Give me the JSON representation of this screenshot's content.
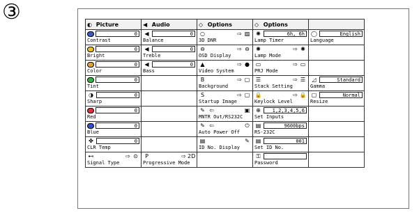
{
  "step_marker": "③",
  "headers": [
    {
      "icon": "picture-icon",
      "glyph": "◐",
      "label": "Picture"
    },
    {
      "icon": "audio-icon",
      "glyph": "◀",
      "label": "Audio"
    },
    {
      "icon": "options-icon",
      "glyph": "◇",
      "label": "Options"
    },
    {
      "icon": "options-icon",
      "glyph": "◇",
      "label": "Options"
    }
  ],
  "rows": [
    [
      {
        "name": "contrast",
        "label": "Contrast",
        "value": "0",
        "swatch": "#3f57c8"
      },
      {
        "name": "balance",
        "label": "Balance",
        "value": "0",
        "glyph": "◀"
      },
      {
        "name": "3d-dnr",
        "label": "3D DNR",
        "glyph": "○",
        "arrow": "⇨",
        "glyph2": "▨"
      },
      {
        "name": "lamp-timer",
        "label": "Lamp Timer",
        "value": "6h,  6h",
        "glyph": "✺"
      },
      {
        "name": "language",
        "label": "Language",
        "value": "English",
        "glyph": "◯"
      }
    ],
    [
      {
        "name": "bright",
        "label": "Bright",
        "value": "0",
        "glyph": "✿",
        "swatch": "#f0c020"
      },
      {
        "name": "treble",
        "label": "Treble",
        "value": "0",
        "glyph": "◀"
      },
      {
        "name": "osd-display",
        "label": "OSD Display",
        "glyph": "⊖",
        "arrow": "⇨",
        "glyph2": "⊖"
      },
      {
        "name": "lamp-mode",
        "label": "Lamp Mode",
        "glyph": "✺",
        "arrow": "⇨",
        "glyph2": "✺"
      },
      {
        "name": "blank-1",
        "label": ""
      }
    ],
    [
      {
        "name": "color",
        "label": "Color",
        "value": "0",
        "swatch": "#e4a030"
      },
      {
        "name": "bass",
        "label": "Bass",
        "value": "0",
        "glyph": "◀"
      },
      {
        "name": "video-system",
        "label": "Video System",
        "glyph": "▲",
        "arrow": "⇨",
        "glyph2": "●"
      },
      {
        "name": "prj-mode",
        "label": "PRJ Mode",
        "glyph": "▭",
        "arrow": "⇨",
        "glyph2": "▭"
      },
      {
        "name": "blank-2",
        "label": ""
      }
    ],
    [
      {
        "name": "tint",
        "label": "Tint",
        "value": "0",
        "swatch": "#3ab04a"
      },
      {
        "name": "blank-3",
        "label": ""
      },
      {
        "name": "background",
        "label": "Background",
        "glyph": "B",
        "arrow": "⇨",
        "glyph2": "▢"
      },
      {
        "name": "stack-setting",
        "label": "Stack Setting",
        "glyph": "☰",
        "arrow": "⇨",
        "glyph2": "☰"
      },
      {
        "name": "gamma",
        "label": "Gamma",
        "value": "Standard",
        "glyph": "◿"
      }
    ],
    [
      {
        "name": "sharp",
        "label": "Sharp",
        "value": "0",
        "glyph": "◑"
      },
      {
        "name": "blank-4",
        "label": ""
      },
      {
        "name": "startup-image",
        "label": "Startup Image",
        "glyph": "S",
        "arrow": "⇨",
        "glyph2": "▢"
      },
      {
        "name": "keylock-level",
        "label": "Keylock Level",
        "glyph": "🔒",
        "arrow": "⇨",
        "glyph2": "🔒"
      },
      {
        "name": "resize",
        "label": "Resize",
        "value": "Normal",
        "glyph": "▢"
      }
    ],
    [
      {
        "name": "red",
        "label": "Red",
        "value": "0",
        "swatch": "#e0303a"
      },
      {
        "name": "blank-5",
        "label": ""
      },
      {
        "name": "mntr-out",
        "label": "MNTR Out/RS232C",
        "glyph": "⇦",
        "glyph1": "✎",
        "glyph2": "▣"
      },
      {
        "name": "set-inputs",
        "label": "Set Inputs",
        "value": "1,2,3,4,5,6",
        "glyph": "⊕"
      },
      {
        "name": "blank-6",
        "label": ""
      }
    ],
    [
      {
        "name": "blue",
        "label": "Blue",
        "value": "0",
        "swatch": "#3050d0"
      },
      {
        "name": "blank-7",
        "label": ""
      },
      {
        "name": "auto-power-off",
        "label": "Auto Power Off",
        "glyph": "⇦",
        "glyph1": "✎",
        "glyph2": "⏻"
      },
      {
        "name": "rs-232c",
        "label": "RS-232C",
        "value": "9600bps",
        "glyph": "▤"
      },
      {
        "name": "blank-8",
        "label": ""
      }
    ],
    [
      {
        "name": "clr-temp",
        "label": "CLR Temp",
        "value": "0",
        "glyph": "✤"
      },
      {
        "name": "blank-9",
        "label": ""
      },
      {
        "name": "id-no-display",
        "label": "ID No. Display",
        "glyph": "▤",
        "glyph2": "✎"
      },
      {
        "name": "set-id-no",
        "label": "Set ID No.",
        "value": "001",
        "glyph": "▤"
      },
      {
        "name": "blank-10",
        "label": ""
      }
    ],
    [
      {
        "name": "signal-type",
        "label": "Signal Type",
        "glyph": "⊷",
        "arrow": "⇨",
        "glyph2": "⊙"
      },
      {
        "name": "progressive-mode",
        "label": "Progressive Mode",
        "glyph": "P",
        "arrow": "⇨",
        "glyph2": "2D"
      },
      {
        "name": "blank-11",
        "label": ""
      },
      {
        "name": "password",
        "label": "Password",
        "value": "",
        "glyph": "⚿"
      },
      {
        "name": "blank-12",
        "label": ""
      }
    ]
  ]
}
